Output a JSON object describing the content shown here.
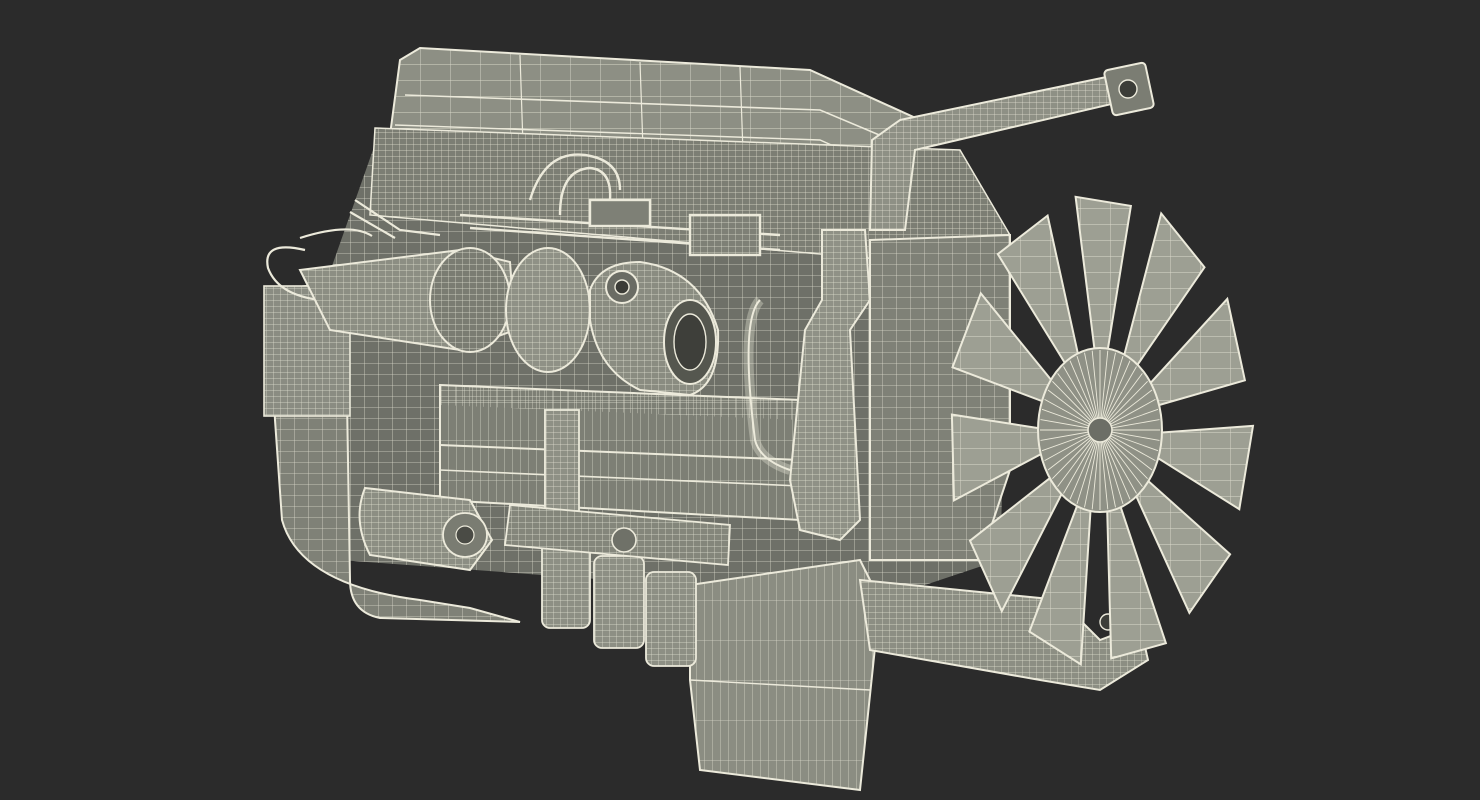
{
  "scene": {
    "subject": "diesel-engine-wireframe",
    "colors": {
      "background": "#2b2b2b",
      "surface": "#85877c",
      "surface_light": "#9d9f93",
      "surface_dark": "#5f6159",
      "wire": "#eceadb"
    }
  }
}
